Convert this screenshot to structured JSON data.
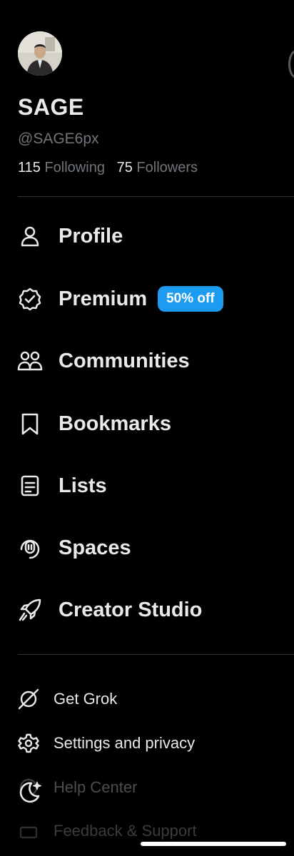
{
  "profile": {
    "name": "SAGE",
    "handle": "@SAGE6px",
    "following_count": "115",
    "following_label": "Following",
    "followers_count": "75",
    "followers_label": "Followers"
  },
  "nav": [
    {
      "label": "Profile",
      "icon": "person-icon"
    },
    {
      "label": "Premium",
      "icon": "verified-badge-icon",
      "badge": "50% off"
    },
    {
      "label": "Communities",
      "icon": "communities-icon"
    },
    {
      "label": "Bookmarks",
      "icon": "bookmark-icon"
    },
    {
      "label": "Lists",
      "icon": "list-icon"
    },
    {
      "label": "Spaces",
      "icon": "spaces-icon"
    },
    {
      "label": "Creator Studio",
      "icon": "rocket-icon"
    }
  ],
  "secondary": [
    {
      "label": "Get Grok",
      "icon": "grok-icon"
    },
    {
      "label": "Settings and privacy",
      "icon": "gear-icon"
    },
    {
      "label": "Help Center",
      "icon": "help-icon"
    },
    {
      "label": "Feedback & Support",
      "icon": "feedback-icon"
    }
  ],
  "floating": {
    "icon": "moon-sparkle-icon"
  },
  "colors": {
    "background": "#000000",
    "text": "#e7e9ea",
    "muted": "#71767b",
    "accent": "#1d9bf0",
    "divider": "#2f3336"
  }
}
